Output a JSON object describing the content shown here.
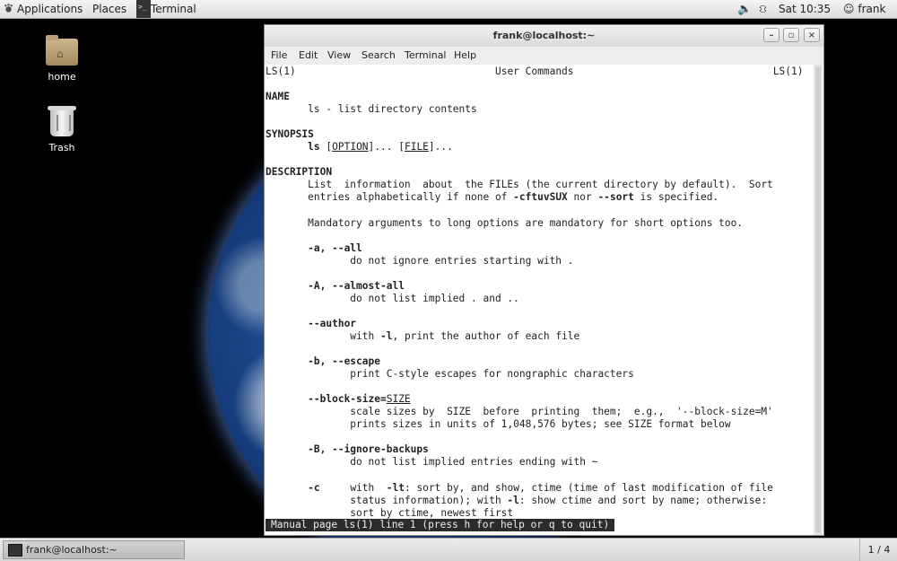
{
  "top_panel": {
    "applications_label": "Applications",
    "places_label": "Places",
    "taskbar_item_label": "Terminal",
    "clock": "Sat 10:35",
    "user": "frank"
  },
  "desktop": {
    "icons": [
      {
        "label": "home"
      },
      {
        "label": "Trash"
      }
    ]
  },
  "window": {
    "title": "frank@localhost:~",
    "buttons": {
      "minimize": "–",
      "maximize": "▫",
      "close": "×"
    },
    "menu": [
      "File",
      "Edit",
      "View",
      "Search",
      "Terminal",
      "Help"
    ]
  },
  "man_page": {
    "header_left": "LS(1)",
    "header_center": "User Commands",
    "header_right": "LS(1)",
    "name_heading": "NAME",
    "name_text": "ls - list directory contents",
    "synopsis_heading": "SYNOPSIS",
    "synopsis_cmd": "ls",
    "synopsis_option": "OPTION",
    "synopsis_file": "FILE",
    "description_heading": "DESCRIPTION",
    "desc_line1": "List  information  about  the FILEs (the current directory by default).  Sort",
    "desc_line2_a": "entries alphabetically if none of ",
    "desc_line2_b": "-cftuvSUX",
    "desc_line2_c": " nor ",
    "desc_line2_d": "--sort",
    "desc_line2_e": " is specified.",
    "desc_line3": "Mandatory arguments to long options are mandatory for short options too.",
    "opt_a": "-a, --all",
    "opt_a_desc": "do not ignore entries starting with .",
    "opt_A": "-A, --almost-all",
    "opt_A_desc": "do not list implied . and ..",
    "opt_author": "--author",
    "opt_author_desc_a": "with ",
    "opt_author_desc_b": "-l",
    "opt_author_desc_c": ", print the author of each file",
    "opt_b": "-b, --escape",
    "opt_b_desc": "print C-style escapes for nongraphic characters",
    "opt_bs": "--block-size=",
    "opt_bs_arg": "SIZE",
    "opt_bs_desc1": "scale sizes by  SIZE  before  printing  them;  e.g.,  '--block-size=M'",
    "opt_bs_desc2": "prints sizes in units of 1,048,576 bytes; see SIZE format below",
    "opt_B": "-B, --ignore-backups",
    "opt_B_desc": "do not list implied entries ending with ~",
    "opt_c": "-c",
    "opt_c_desc1_a": "with  ",
    "opt_c_desc1_b": "-lt",
    "opt_c_desc1_c": ": sort by, and show, ctime (time of last modification of file",
    "opt_c_desc2_a": "status information); with ",
    "opt_c_desc2_b": "-l",
    "opt_c_desc2_c": ": show ctime and sort by name; otherwise:",
    "opt_c_desc3": "sort by ctime, newest first",
    "status_line": "Manual page ls(1) line 1 (press h for help or q to quit)"
  },
  "bottom_panel": {
    "task_label": "frank@localhost:~",
    "workspace": "1 / 4"
  },
  "colors": {
    "status_bg": "#2b2b2b",
    "panel_bg": "#e4e4e4",
    "desktop_bg": "#000000"
  }
}
